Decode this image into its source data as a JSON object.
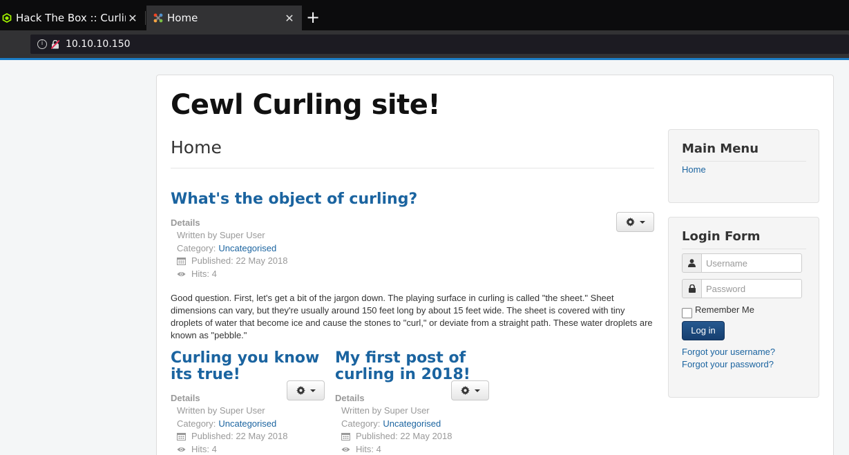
{
  "browser": {
    "tabs": [
      {
        "title": "Hack The Box :: Curling",
        "active": false
      },
      {
        "title": "Home",
        "active": true
      }
    ],
    "new_tab_label": "+",
    "close_label": "✕",
    "url": "10.10.10.150"
  },
  "site": {
    "title": "Cewl Curling site!"
  },
  "main": {
    "page_heading": "Home",
    "articles": [
      {
        "title": "What's the object of curling?",
        "details_label": "Details",
        "written_by": "Written by Super User",
        "category_label": "Category:",
        "category": "Uncategorised",
        "published": "Published: 22 May 2018",
        "hits": "Hits: 4",
        "body": "Good question. First, let's get a bit of the jargon down. The playing surface in curling is called \"the sheet.\" Sheet dimensions can vary, but they're usually around 150 feet long by about 15 feet wide. The sheet is covered with tiny droplets of water that become ice and cause the stones to \"curl,\" or deviate from a straight path. These water droplets are known as \"pebble.\""
      },
      {
        "title": "Curling you know its true!",
        "details_label": "Details",
        "written_by": "Written by Super User",
        "category_label": "Category:",
        "category": "Uncategorised",
        "published": "Published: 22 May 2018",
        "hits": "Hits: 4"
      },
      {
        "title": "My first post of curling in 2018!",
        "details_label": "Details",
        "written_by": "Written by Super User",
        "category_label": "Category:",
        "category": "Uncategorised",
        "published": "Published: 22 May 2018",
        "hits": "Hits: 4"
      }
    ]
  },
  "sidebar": {
    "main_menu": {
      "title": "Main Menu",
      "items": [
        "Home"
      ]
    },
    "login_form": {
      "title": "Login Form",
      "username_placeholder": "Username",
      "password_placeholder": "Password",
      "remember_label": "Remember Me",
      "login_button": "Log in",
      "forgot_username": "Forgot your username?",
      "forgot_password": "Forgot your password?"
    }
  },
  "colors": {
    "link": "#1b64a0",
    "accent": "#1b7cc5",
    "login_button": "#1f4e8c"
  }
}
